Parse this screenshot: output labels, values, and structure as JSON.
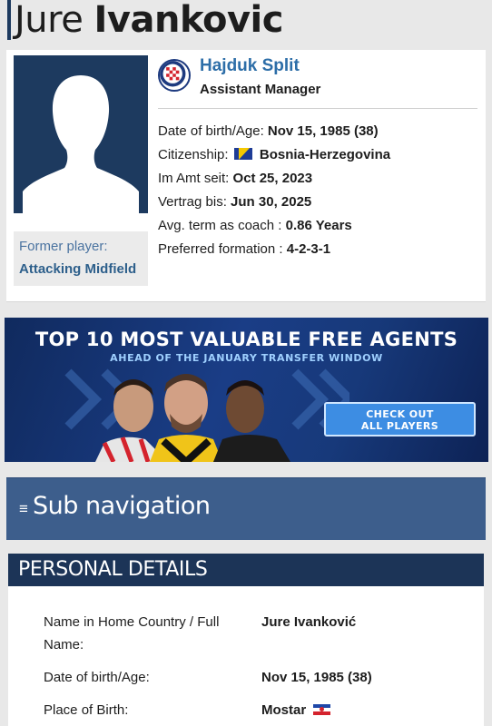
{
  "header": {
    "first_name": "Jure",
    "last_name": "Ivankovic"
  },
  "profile": {
    "club_name": "Hajduk Split",
    "role": "Assistant Manager",
    "former_label": "Former player:",
    "former_value": "Attacking Midfield",
    "facts": [
      {
        "label": "Date of birth/Age:",
        "value": "Nov 15, 1985 (38)"
      },
      {
        "label": "Citizenship:",
        "value": "Bosnia-Herzegovina"
      },
      {
        "label": "Im Amt seit:",
        "value": "Oct 25, 2023"
      },
      {
        "label": "Vertrag bis:",
        "value": "Jun 30, 2025"
      },
      {
        "label": "Avg. term as coach :",
        "value": "0.86 Years"
      },
      {
        "label": "Preferred formation :",
        "value": "4-2-3-1"
      }
    ]
  },
  "ad": {
    "title": "TOP 10 MOST VALUABLE FREE AGENTS",
    "subtitle": "AHEAD OF THE JANUARY TRANSFER WINDOW",
    "cta_line1": "CHECK OUT",
    "cta_line2": "ALL PLAYERS"
  },
  "subnav": {
    "icon": "≡",
    "label": "Sub navigation"
  },
  "personal_details": {
    "heading": "PERSONAL DETAILS",
    "rows": [
      {
        "label": "Name in Home Country / Full Name:",
        "value": "Jure Ivanković"
      },
      {
        "label": "Date of birth/Age:",
        "value": "Nov 15, 1985 (38)"
      },
      {
        "label": "Place of Birth:",
        "value": "Mostar"
      }
    ]
  },
  "colors": {
    "brand_navy": "#1c3457",
    "subnav_blue": "#3d5e8c",
    "link_blue": "#2d6ea8"
  }
}
